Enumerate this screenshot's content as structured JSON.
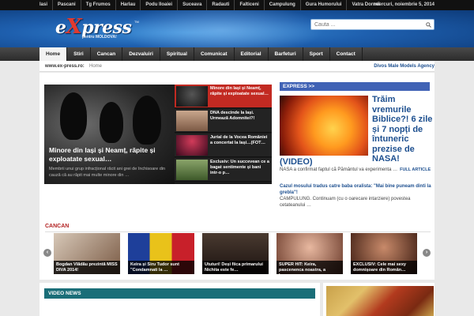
{
  "topbar": {
    "links": [
      "Iasi",
      "Pascani",
      "Tg Frumos",
      "Harlau",
      "Podu Iloaiei",
      "Suceava",
      "Radauti",
      "Falticeni",
      "Campulung",
      "Gura Humorului",
      "Vatra Dornei"
    ],
    "date": "miercuri, noiembrie 5, 2014"
  },
  "header": {
    "logo_word_left": "e",
    "logo_word_x": "X",
    "logo_word_right": "press",
    "logo_tm": "TM",
    "logo_tagline": "pentru MOLDOVA!",
    "search_placeholder": "Cauta ..."
  },
  "nav": {
    "items": [
      "Home",
      "Stiri",
      "Cancan",
      "Dezvaluiri",
      "Spiritual",
      "Comunicat",
      "Editorial",
      "Barfeturi",
      "Sport",
      "Contact"
    ],
    "active": "Home"
  },
  "breadcrumb": {
    "site": "www.ex-press.ro:",
    "home": "Home",
    "right_link": "Divos Male Models Agency"
  },
  "slider": {
    "main_title": "Minore din Iași și Neamț, răpite și exploatate sexual…",
    "main_desc": "Membrii unui grup infracțional răcit ani grei de închisoare din cauză că au răpit mai multe minore din …",
    "thumbs": [
      "Minore din Iași și Neamț, răpite și exploatate sexual…",
      "DNA descinde la Iași. Urmează Adomnitei?!",
      "Jurial de la Vocea României a concertat la Iași…(FOT…",
      "Exclusiv: Un succevean ce a bagat sentimente și bani intr-o p…"
    ]
  },
  "express": {
    "header": "EXPRESS >>",
    "title": "Trăim vremurile Biblice?! 6 zile și 7 nopți de întuneric prezise de NASA!",
    "title_tail": "(VIDEO)",
    "desc": "NASA a confirmat faptul că Pământul va experimenta …",
    "full_article": "FULL ARTICLE",
    "story2_title": "Cazul mosului tradus catre baba oralista: \"Mai bine puneam dinti la grebla\"!",
    "story2_desc": "CAMPULUNG. Continuam (cu o oarecare intarziere) povestea cetateanului …"
  },
  "cancan": {
    "header": "CANCAN",
    "prev": "‹",
    "next": "›",
    "items": [
      "Bogdan Vlădău prezintă MISS DIVA 2014!",
      "Keira și Siru Tudor sunt \"Condamnati la …",
      "Ututuri! Deși fiica primarului Nichita este fe…",
      "SUPER HIT: Keira, pascenenca noastra, a lansa…",
      "EXCLUSIV: Cele mai sexy domnișoare din Român…"
    ]
  },
  "video": {
    "header": "VIDEO NEWS"
  },
  "colors": {
    "accent_blue": "#1d4f8f",
    "express_bar": "#4062b5",
    "thumb_active": "#c22a22",
    "cancan_red": "#b22222",
    "video_bar": "#1a6e78"
  }
}
